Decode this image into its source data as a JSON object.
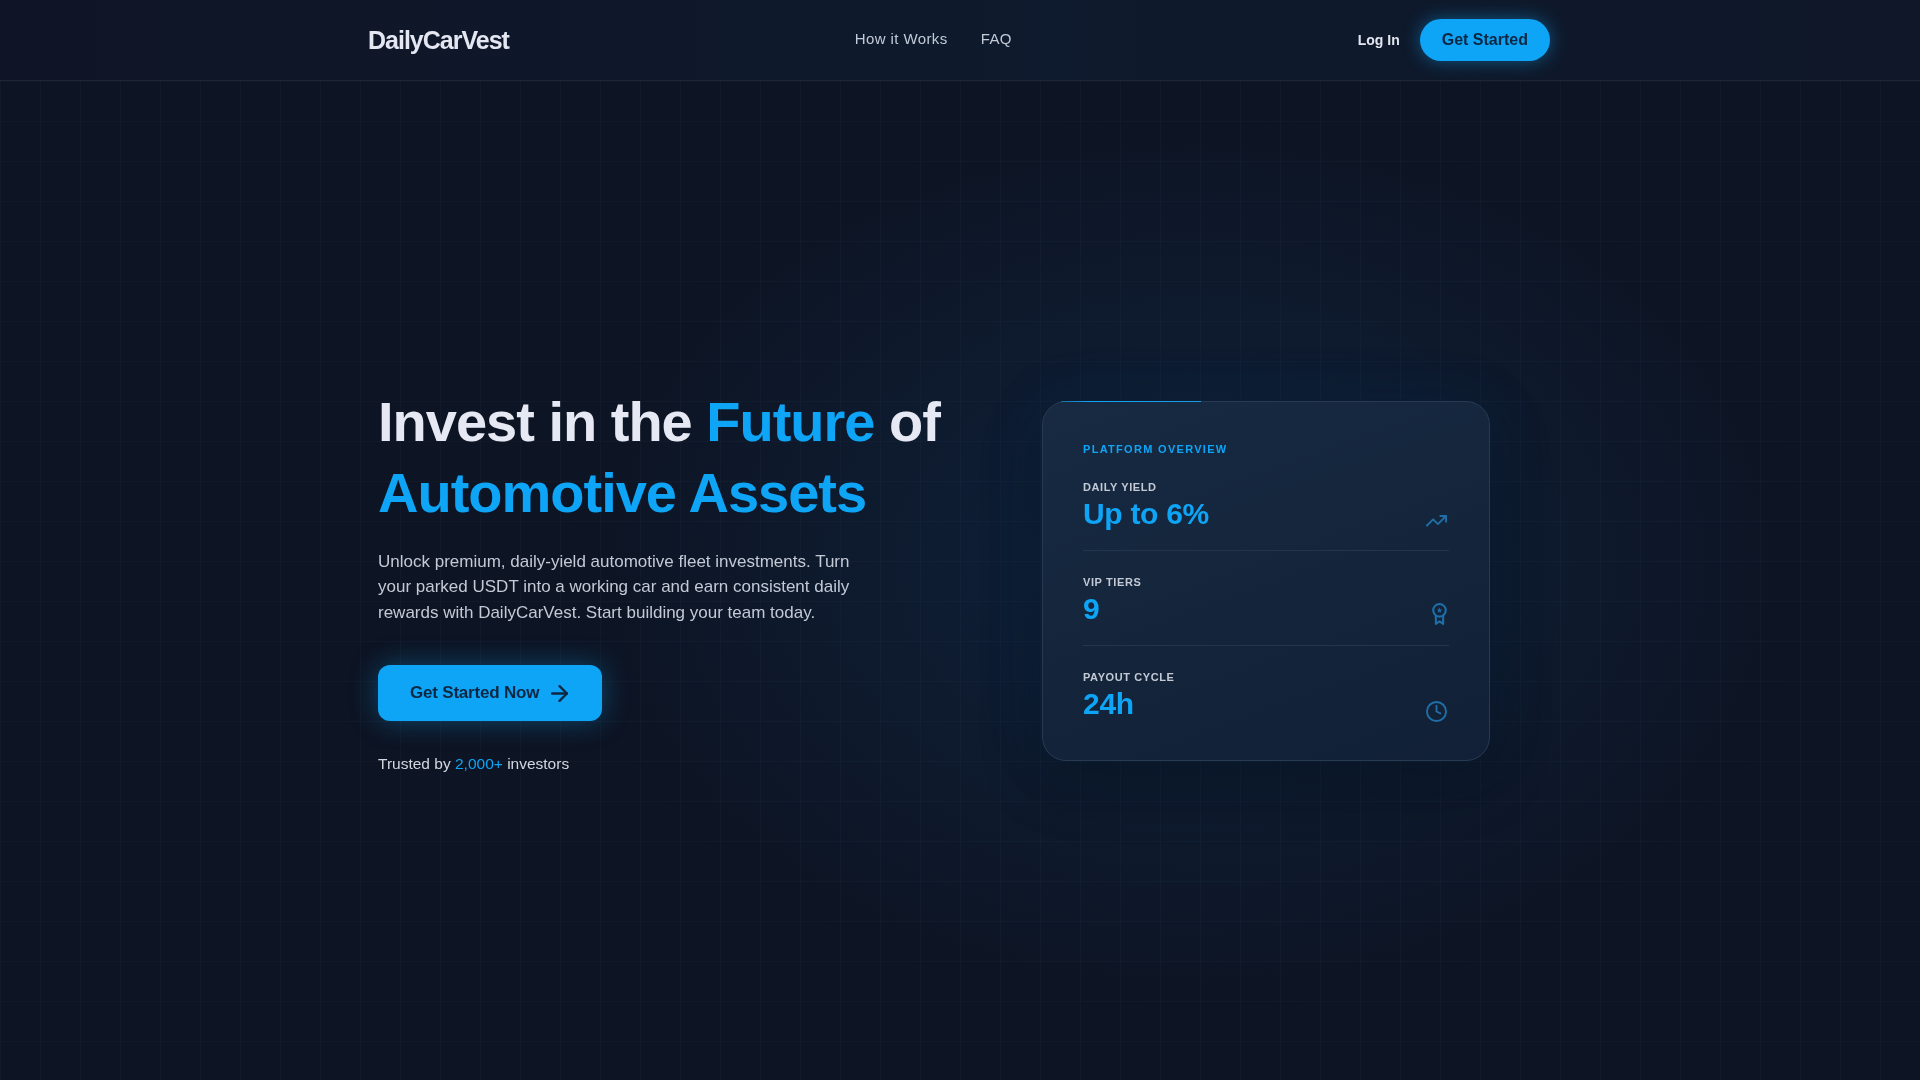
{
  "header": {
    "logo": "DailyCarVest",
    "nav": [
      {
        "label": "How it Works"
      },
      {
        "label": "FAQ"
      }
    ],
    "login": "Log In",
    "cta": "Get Started"
  },
  "hero": {
    "title_lines": [
      [
        {
          "text": "Invest in the",
          "highlight": false
        },
        {
          "text": "Future",
          "highlight": true
        },
        {
          "text": "of",
          "highlight": false
        }
      ],
      [
        {
          "text": "Automotive Assets",
          "highlight": true
        }
      ]
    ],
    "description": "Unlock premium, daily-yield automotive fleet investments. Turn your parked USDT into a working car and earn consistent daily rewards with DailyCarVest. Start building your team today.",
    "cta": "Get Started Now",
    "trust": [
      {
        "text": "Trusted by",
        "highlight": false
      },
      {
        "text": "2,000+",
        "highlight": true
      },
      {
        "text": "investors",
        "highlight": false
      }
    ]
  },
  "overview_card": {
    "title": "PLATFORM OVERVIEW",
    "stats": [
      {
        "label": "DAILY YIELD",
        "value": "Up to 6%"
      },
      {
        "label": "VIP TIERS",
        "value": "9"
      },
      {
        "label": "PAYOUT CYCLE",
        "value": "24h"
      }
    ]
  }
}
